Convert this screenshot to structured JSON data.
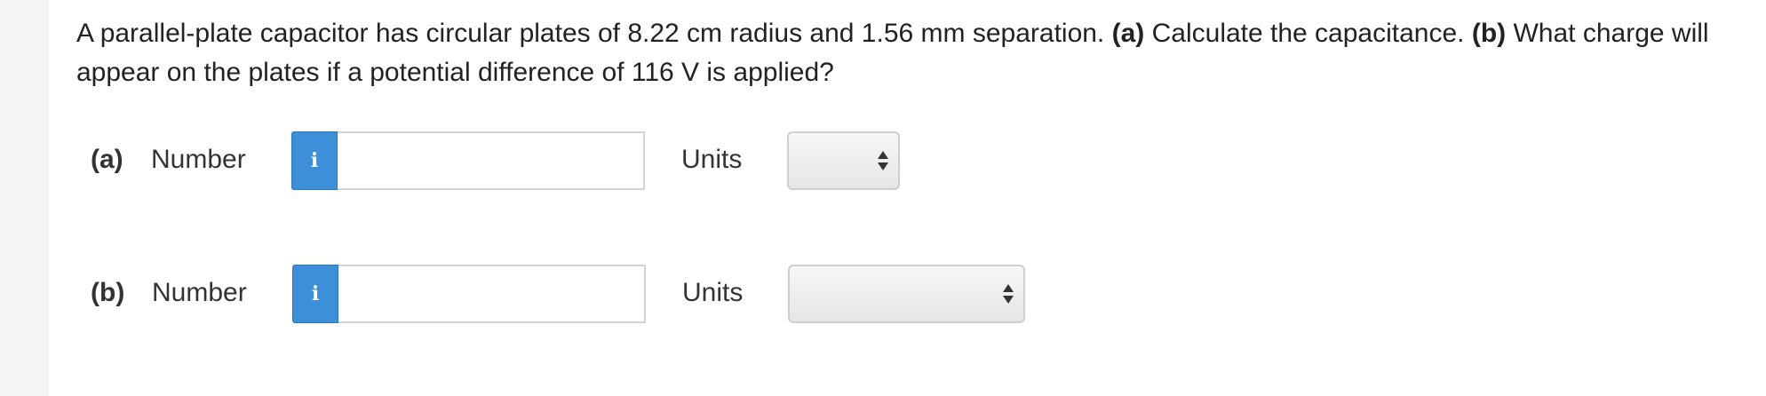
{
  "question": {
    "part1": "A parallel-plate capacitor has circular plates of 8.22 cm radius and 1.56 mm separation. ",
    "part_a_tag": "(a)",
    "part2": " Calculate the capacitance. ",
    "part_b_tag": "(b)",
    "part3": " What charge will appear on the plates if a potential difference of 116 V is applied?"
  },
  "parts": [
    {
      "label": "(a)",
      "number_label": "Number",
      "info_icon": "i",
      "input_value": "",
      "units_label": "Units",
      "units_selected": ""
    },
    {
      "label": "(b)",
      "number_label": "Number",
      "info_icon": "i",
      "input_value": "",
      "units_label": "Units",
      "units_selected": ""
    }
  ],
  "colors": {
    "info_button": "#3d8fd8",
    "page_background": "#f4f4f4",
    "panel_background": "#ffffff"
  }
}
